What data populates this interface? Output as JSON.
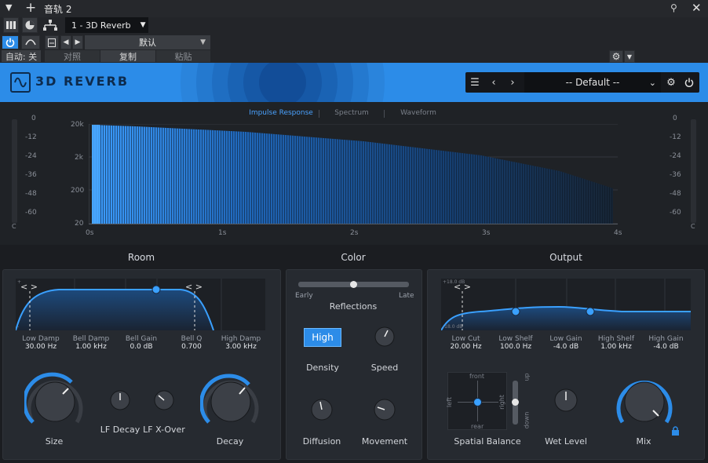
{
  "host": {
    "window_title": "音轨 2",
    "plugin_slot": "1 - 3D Reverb",
    "preset_default": "默认",
    "auto_label": "自动: 关",
    "compare_label": "对照",
    "copy_label": "复制",
    "paste_label": "粘贴"
  },
  "plugin": {
    "title": "3D REVERB",
    "preset": "-- Default --"
  },
  "display": {
    "tabs": [
      "Impulse Response",
      "Spectrum",
      "Waveform"
    ],
    "active_tab": "Impulse Response",
    "freq_ticks": [
      "20k",
      "2k",
      "200",
      "20"
    ],
    "time_ticks": [
      "0s",
      "1s",
      "2s",
      "3s",
      "4s"
    ],
    "db_ticks": [
      "0",
      "-12",
      "-24",
      "-36",
      "-48",
      "-60"
    ],
    "meter_clip": "C"
  },
  "sections": {
    "room": "Room",
    "color": "Color",
    "output": "Output"
  },
  "room": {
    "eq_params": [
      {
        "label": "Low Damp",
        "value": "30.00 Hz"
      },
      {
        "label": "Bell Damp",
        "value": "1.00 kHz"
      },
      {
        "label": "Bell Gain",
        "value": "0.0 dB"
      },
      {
        "label": "Bell Q",
        "value": "0.700"
      },
      {
        "label": "High Damp",
        "value": "3.00 kHz"
      }
    ],
    "size_label": "Size",
    "lf_decay_label": "LF Decay",
    "lf_xover_label": "LF X-Over",
    "decay_label": "Decay",
    "eq_scale_top": "+",
    "eq_scale_bottom": "-"
  },
  "color": {
    "early_label": "Early",
    "late_label": "Late",
    "reflections_label": "Reflections",
    "reflections_value": 0.5,
    "density_button": "High",
    "density_label": "Density",
    "speed_label": "Speed",
    "diffusion_label": "Diffusion",
    "movement_label": "Movement"
  },
  "output": {
    "eq_params": [
      {
        "label": "Low Cut",
        "value": "20.00 Hz"
      },
      {
        "label": "Low Shelf",
        "value": "100.0 Hz"
      },
      {
        "label": "Low Gain",
        "value": "-4.0 dB"
      },
      {
        "label": "High Shelf",
        "value": "1.00 kHz"
      },
      {
        "label": "High Gain",
        "value": "-4.0 dB"
      }
    ],
    "eq_scale_top": "+18.0 dB",
    "eq_scale_bottom": "-18.0 dB",
    "spatial": {
      "front": "front",
      "rear": "rear",
      "left": "left",
      "right": "right",
      "up": "up",
      "down": "down",
      "label": "Spatial Balance"
    },
    "wet_level_label": "Wet Level",
    "mix_label": "Mix"
  },
  "colors": {
    "accent": "#2c8ce8",
    "accent_bright": "#3aa0ff",
    "panel": "#262a30",
    "background": "#1b1d21"
  }
}
